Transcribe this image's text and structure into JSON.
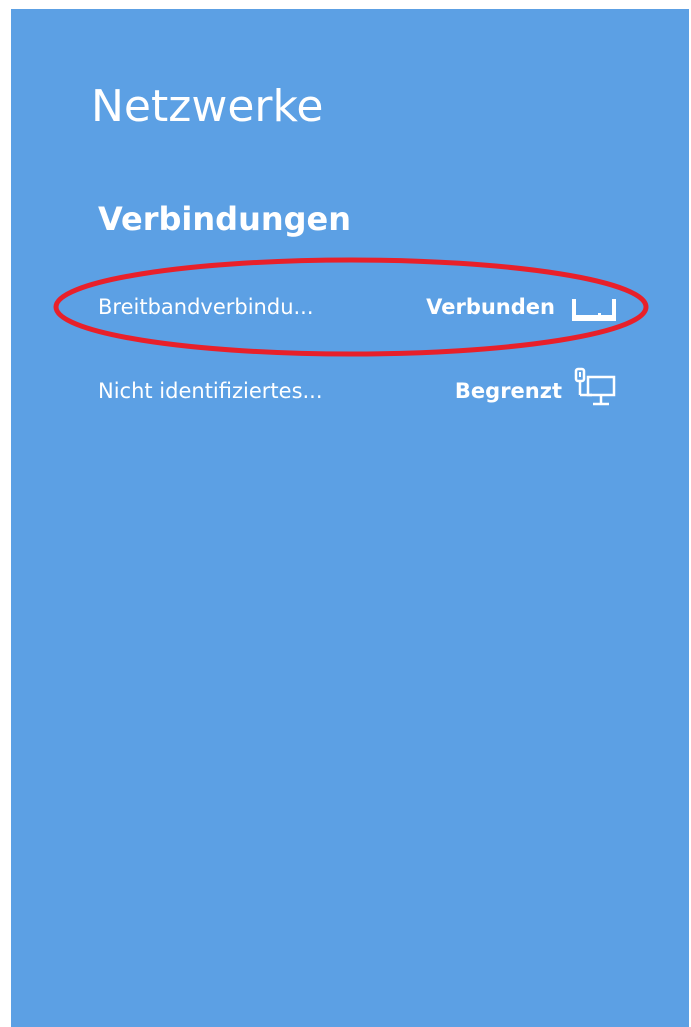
{
  "panel": {
    "title": "Netzwerke",
    "background_color": "#5ca0e4"
  },
  "connections": {
    "section_title": "Verbindungen",
    "items": [
      {
        "name": "Breitbandverbindu...",
        "status": "Verbunden",
        "icon": "broadband-connection-icon",
        "highlighted": true
      },
      {
        "name": "Nicht identifiziertes...",
        "status": "Begrenzt",
        "icon": "wired-network-icon",
        "highlighted": false
      }
    ]
  },
  "annotation": {
    "shape": "ellipse",
    "color": "#e8202a"
  }
}
